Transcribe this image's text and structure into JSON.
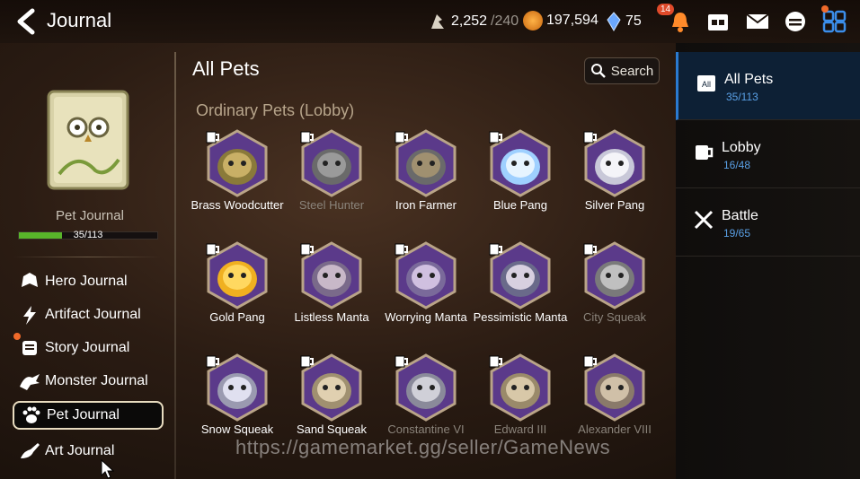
{
  "header": {
    "title": "Journal",
    "stamina_value": "2,252",
    "stamina_max": "/240",
    "gold_value": "197,594",
    "crystal_value": "75",
    "notification_count": "14"
  },
  "left": {
    "book_label": "Pet Journal",
    "progress_text": "35/113",
    "progress_fraction": 0.31,
    "nav_items": [
      {
        "label": "Hero Journal"
      },
      {
        "label": "Artifact Journal"
      },
      {
        "label": "Story Journal"
      },
      {
        "label": "Monster Journal"
      },
      {
        "label": "Pet Journal"
      },
      {
        "label": "Art Journal"
      }
    ]
  },
  "main": {
    "title": "All Pets",
    "search_label": "Search",
    "section_label": "Ordinary Pets (Lobby)",
    "pets": [
      {
        "name": "Brass Woodcutter"
      },
      {
        "name": "Steel Hunter"
      },
      {
        "name": "Iron Farmer"
      },
      {
        "name": "Blue Pang"
      },
      {
        "name": "Silver Pang"
      },
      {
        "name": "Gold Pang"
      },
      {
        "name": "Listless Manta"
      },
      {
        "name": "Worrying Manta"
      },
      {
        "name": "Pessimistic Manta"
      },
      {
        "name": "City Squeak"
      },
      {
        "name": "Snow Squeak"
      },
      {
        "name": "Sand Squeak"
      },
      {
        "name": "Constantine VI"
      },
      {
        "name": "Edward III"
      },
      {
        "name": "Alexander VIII"
      }
    ],
    "watermark": "https://gamemarket.gg/seller/GameNews"
  },
  "right": {
    "tabs": [
      {
        "label": "All Pets",
        "count": "35/113"
      },
      {
        "label": "Lobby",
        "count": "16/48"
      },
      {
        "label": "Battle",
        "count": "19/65"
      }
    ]
  },
  "colors": {
    "accent_blue": "#2a7ad0",
    "progress_green": "#58b52a",
    "hex_purple": "#5b3a8a",
    "hex_border": "#b9a488"
  }
}
